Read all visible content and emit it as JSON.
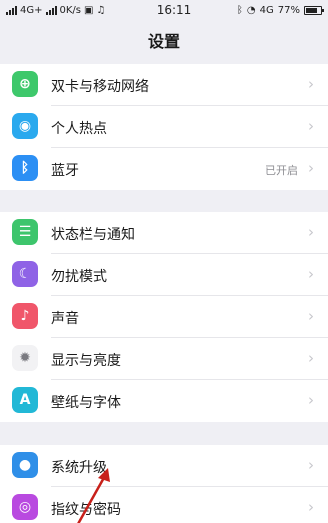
{
  "status": {
    "left_text": "4G+",
    "speed": "0K/s",
    "time": "16:11",
    "network_right": "4G",
    "battery": "77%",
    "battery_level": 0.77
  },
  "title": "设置",
  "groups": [
    {
      "items": [
        {
          "label": "双卡与移动网络",
          "icon": "sim-card-icon",
          "color": "#3ec86b",
          "glyph": "⊕"
        },
        {
          "label": "个人热点",
          "icon": "hotspot-icon",
          "color": "#2aa9ee",
          "glyph": "◉"
        },
        {
          "label": "蓝牙",
          "icon": "bluetooth-icon",
          "color": "#2c8ff4",
          "glyph": "ᛒ",
          "value": "已开启"
        }
      ]
    },
    {
      "items": [
        {
          "label": "状态栏与通知",
          "icon": "notification-icon",
          "color": "#3dc56c",
          "glyph": "☰"
        },
        {
          "label": "勿扰模式",
          "icon": "moon-icon",
          "color": "#8f63e6",
          "glyph": "☾"
        },
        {
          "label": "声音",
          "icon": "speaker-icon",
          "color": "#f0566a",
          "glyph": "♪"
        },
        {
          "label": "显示与亮度",
          "icon": "brightness-icon",
          "color": "#f2f2f4",
          "glyph": "✹",
          "glyph_color": "#7a7a80"
        },
        {
          "label": "壁纸与字体",
          "icon": "wallpaper-icon",
          "color": "#22b8d6",
          "glyph": "A"
        }
      ]
    },
    {
      "items": [
        {
          "label": "系统升级",
          "icon": "system-update-icon",
          "color": "#2f8fe8",
          "glyph": "●"
        },
        {
          "label": "指纹与密码",
          "icon": "fingerprint-icon",
          "color": "#b94ae0",
          "glyph": "◎"
        }
      ]
    }
  ]
}
